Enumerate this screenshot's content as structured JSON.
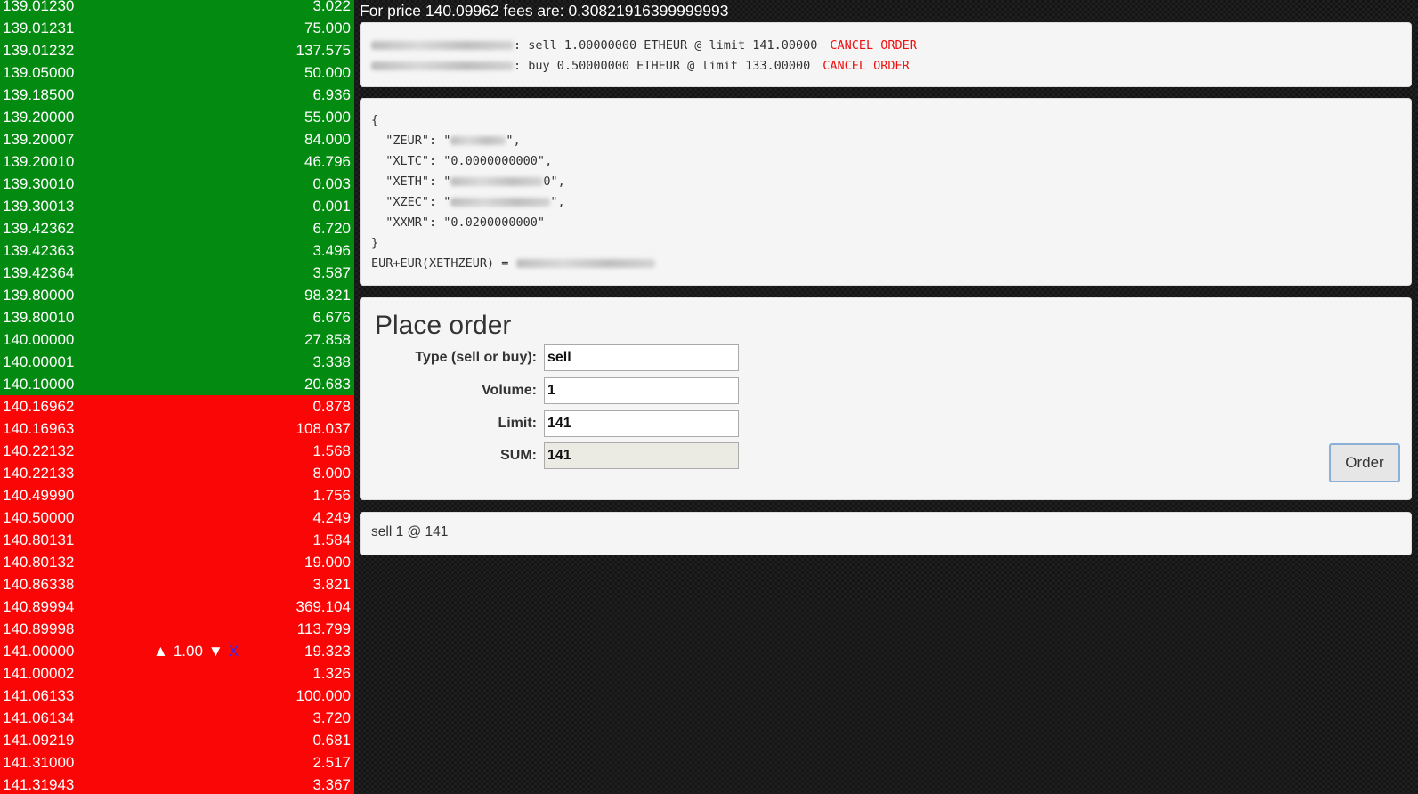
{
  "orderbook": {
    "bids": [
      {
        "price": "139.01230",
        "volume": "3.022"
      },
      {
        "price": "139.01231",
        "volume": "75.000"
      },
      {
        "price": "139.01232",
        "volume": "137.575"
      },
      {
        "price": "139.05000",
        "volume": "50.000"
      },
      {
        "price": "139.18500",
        "volume": "6.936"
      },
      {
        "price": "139.20000",
        "volume": "55.000"
      },
      {
        "price": "139.20007",
        "volume": "84.000"
      },
      {
        "price": "139.20010",
        "volume": "46.796"
      },
      {
        "price": "139.30010",
        "volume": "0.003"
      },
      {
        "price": "139.30013",
        "volume": "0.001"
      },
      {
        "price": "139.42362",
        "volume": "6.720"
      },
      {
        "price": "139.42363",
        "volume": "3.496"
      },
      {
        "price": "139.42364",
        "volume": "3.587"
      },
      {
        "price": "139.80000",
        "volume": "98.321"
      },
      {
        "price": "139.80010",
        "volume": "6.676"
      },
      {
        "price": "140.00000",
        "volume": "27.858"
      },
      {
        "price": "140.00001",
        "volume": "3.338"
      },
      {
        "price": "140.10000",
        "volume": "20.683"
      }
    ],
    "asks": [
      {
        "price": "140.16962",
        "volume": "0.878"
      },
      {
        "price": "140.16963",
        "volume": "108.037"
      },
      {
        "price": "140.22132",
        "volume": "1.568"
      },
      {
        "price": "140.22133",
        "volume": "8.000"
      },
      {
        "price": "140.49990",
        "volume": "1.756"
      },
      {
        "price": "140.50000",
        "volume": "4.249"
      },
      {
        "price": "140.80131",
        "volume": "1.584"
      },
      {
        "price": "140.80132",
        "volume": "19.000"
      },
      {
        "price": "140.86338",
        "volume": "3.821"
      },
      {
        "price": "140.89994",
        "volume": "369.104"
      },
      {
        "price": "140.89998",
        "volume": "113.799"
      },
      {
        "price": "141.00000",
        "volume": "19.323",
        "control": {
          "up": "▲",
          "amount": "1.00",
          "down": "▼",
          "remove": "X"
        }
      },
      {
        "price": "141.00002",
        "volume": "1.326"
      },
      {
        "price": "141.06133",
        "volume": "100.000"
      },
      {
        "price": "141.06134",
        "volume": "3.720"
      },
      {
        "price": "141.09219",
        "volume": "0.681"
      },
      {
        "price": "141.31000",
        "volume": "2.517"
      },
      {
        "price": "141.31943",
        "volume": "3.367"
      }
    ],
    "colors": {
      "bid": "#038a10",
      "ask": "#fb0606"
    }
  },
  "fees_line": "For price 140.09962 fees are: 0.30821916399999993",
  "open_orders": [
    {
      "id_suffix": ":",
      "text": " sell 1.00000000 ETHEUR @ limit 141.00000",
      "cancel_label": "CANCEL ORDER"
    },
    {
      "id_suffix": ":",
      "text": " buy 0.50000000 ETHEUR @ limit 133.00000",
      "cancel_label": "CANCEL ORDER"
    }
  ],
  "balance": {
    "open_brace": "{",
    "lines": [
      {
        "key": "  \"ZEUR\": \"",
        "value_hidden": true,
        "tail": "\","
      },
      {
        "key": "  \"XLTC\": \"0.0000000000\",",
        "value_hidden": false,
        "tail": ""
      },
      {
        "key": "  \"XETH\": \"",
        "value_hidden": true,
        "tail": "0\","
      },
      {
        "key": "  \"XZEC\": \"",
        "value_hidden": true,
        "tail": "\","
      },
      {
        "key": "  \"XXMR\": \"0.0200000000\"",
        "value_hidden": false,
        "tail": ""
      }
    ],
    "close_brace": "}",
    "total_label": "EUR+EUR(XETHZEUR) = "
  },
  "place_order": {
    "title": "Place order",
    "type_label": "Type (sell or buy):",
    "type_value": "sell",
    "volume_label": "Volume:",
    "volume_value": "1",
    "limit_label": "Limit:",
    "limit_value": "141",
    "sum_label": "SUM:",
    "sum_value": "141",
    "order_button": "Order"
  },
  "status_text": "sell 1 @ 141"
}
